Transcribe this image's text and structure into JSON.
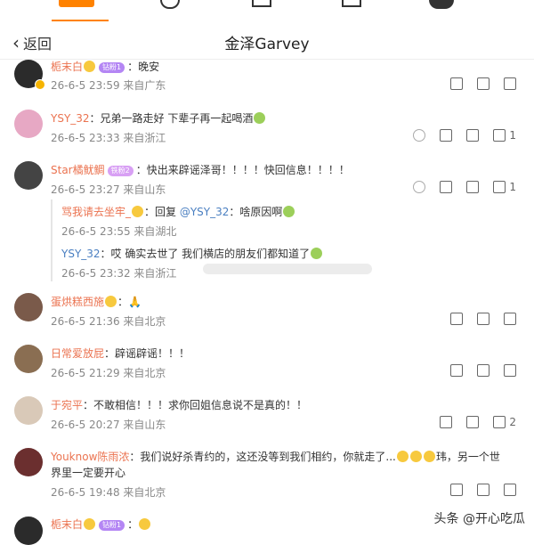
{
  "header": {
    "back_label": "返回",
    "title": "金泽Garvey"
  },
  "comments": [
    {
      "user": "栀末白",
      "badge": "钻粉1",
      "text": "：晚安",
      "meta": "26-6-5 23:59 来自广东",
      "likes": ""
    },
    {
      "user": "YSY_32",
      "badge": "",
      "text": "：兄弟一路走好 下辈子再一起喝酒",
      "meta": "26-6-5 23:33 来自浙江",
      "likes": "1"
    },
    {
      "user": "Star橘鱿鲷",
      "badge": "铁粉2",
      "text": "：快出来辟谣泽哥！！！！快回信息！！！！",
      "meta": "26-6-5 23:27 来自山东",
      "likes": "1"
    },
    {
      "user": "蛋烘糕西施",
      "badge": "",
      "text": "：",
      "meta": "26-6-5 21:36 来自北京",
      "likes": ""
    },
    {
      "user": "日常爱放屁",
      "badge": "",
      "text": "：辟谣辟谣！！！",
      "meta": "26-6-5 21:29 来自北京",
      "likes": ""
    },
    {
      "user": "于宛平",
      "badge": "",
      "text": "：不敢相信！！！求你回姐信息说不是真的！！",
      "meta": "26-6-5 20:27 来自山东",
      "likes": "2"
    },
    {
      "user": "Youknow陈雨浓",
      "badge": "",
      "text": "：我们说好杀青约的，这还没等到我们相约，你就走了...",
      "text2": "玮，另一个世",
      "text3": "界里一定要开心",
      "meta": "26-6-5 19:48 来自北京",
      "likes": ""
    },
    {
      "user": "栀末白",
      "badge": "钻粉1",
      "text": "：",
      "meta": "",
      "likes": ""
    }
  ],
  "replies": [
    {
      "user": "骂我请去坐牢_",
      "text": "：回复 ",
      "mention": "@YSY_32",
      "text_after": "：啥原因啊",
      "meta": "26-6-5 23:55 来自湖北"
    },
    {
      "user": "YSY_32",
      "text": "：哎 确实去世了 我们横店的朋友们都知道了",
      "meta": "26-6-5 23:32 来自浙江"
    }
  ],
  "watermark": "头条 @开心吃瓜",
  "colors": {
    "username": "#eb7350",
    "link": "#4a7fc1",
    "meta": "#888888"
  }
}
